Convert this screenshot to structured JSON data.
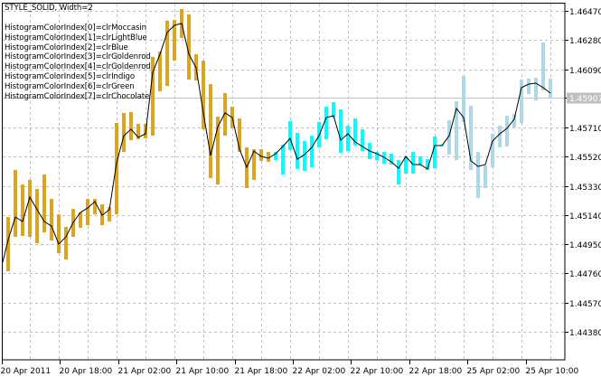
{
  "legend": {
    "title": "STYLE_SOLID,  Width=2",
    "lines": [
      "HistogramColorIndex[0]=clrMoccasin",
      "HistogramColorIndex[1]=clrLightBlue",
      "HistogramColorIndex[2]=clrBlue",
      "HistogramColorIndex[3]=clrGoldenrod",
      "HistogramColorIndex[4]=clrGoldenrod",
      "HistogramColorIndex[5]=clrIndigo",
      "HistogramColorIndex[6]=clrGreen",
      "HistogramColorIndex[7]=clrChocolate"
    ]
  },
  "chart_data": {
    "type": "bar",
    "subtype": "color-histogram2 with close line",
    "ylim": [
      1.4428,
      1.4654
    ],
    "y_ticks": [
      "1.46470",
      "1.46280",
      "1.46090",
      "1.45907",
      "1.45710",
      "1.45520",
      "1.45330",
      "1.45140",
      "1.44950",
      "1.44760",
      "1.44570",
      "1.44380"
    ],
    "current_price": "1.45907",
    "x_tick_labels": [
      "20 Apr 2011",
      "20 Apr 18:00",
      "21 Apr 02:00",
      "21 Apr 10:00",
      "21 Apr 18:00",
      "22 Apr 02:00",
      "22 Apr 10:00",
      "22 Apr 18:00",
      "25 Apr 02:00",
      "25 Apr 10:00"
    ],
    "grid": true,
    "colors": {
      "goldenrod": "#daa520",
      "cyan": "#00ffff",
      "lightblue": "#add8e6",
      "line": "#000000",
      "grid": "#c0c0c0",
      "price_line": "#c0c0c0"
    },
    "color_segments": [
      {
        "from": 0,
        "to": 37,
        "color": "goldenrod"
      },
      {
        "from": 38,
        "to": 61,
        "color": "cyan"
      },
      {
        "from": 62,
        "to": 76,
        "color": "lightblue"
      }
    ],
    "high": [
      1.44803,
      1.45127,
      1.45434,
      1.45339,
      1.45369,
      1.4531,
      1.45404,
      1.45245,
      1.45145,
      1.45063,
      1.4518,
      1.45157,
      1.45245,
      1.45245,
      1.4521,
      1.45192,
      1.4574,
      1.45805,
      1.45811,
      1.45734,
      1.45734,
      1.4617,
      1.46205,
      1.46406,
      1.46411,
      1.46482,
      1.46447,
      1.46188,
      1.46146,
      1.45993,
      1.45781,
      1.45934,
      1.45846,
      1.45769,
      1.45581,
      1.45569,
      1.45569,
      1.45551,
      1.45551,
      1.45599,
      1.45752,
      1.45675,
      1.45622,
      1.45657,
      1.45746,
      1.45846,
      1.45875,
      1.45828,
      1.45722,
      1.45769,
      1.45699,
      1.4561,
      1.45551,
      1.45551,
      1.4554,
      1.45498,
      1.45522,
      1.45551,
      1.45522,
      1.45504,
      1.45652,
      1.45599,
      1.45758,
      1.45881,
      1.46046,
      1.45852,
      1.45551,
      1.45463,
      1.45669,
      1.45722,
      1.45787,
      1.45799,
      1.46023,
      1.46029,
      1.46034,
      1.46264,
      1.46029
    ],
    "low": [
      1.44774,
      1.44774,
      1.44998,
      1.45004,
      1.44998,
      1.44957,
      1.45027,
      1.44974,
      1.44892,
      1.44851,
      1.44998,
      1.45057,
      1.45074,
      1.45145,
      1.45074,
      1.45098,
      1.45145,
      1.45551,
      1.45628,
      1.45634,
      1.4564,
      1.45657,
      1.45946,
      1.45981,
      1.46146,
      1.46294,
      1.46023,
      1.46017,
      1.45699,
      1.45381,
      1.45339,
      1.45657,
      1.45705,
      1.45551,
      1.45316,
      1.45369,
      1.45493,
      1.45487,
      1.45498,
      1.45404,
      1.45563,
      1.4544,
      1.45428,
      1.45451,
      1.45581,
      1.45634,
      1.45775,
      1.45546,
      1.45557,
      1.45593,
      1.45557,
      1.45504,
      1.45498,
      1.45475,
      1.45469,
      1.45339,
      1.4541,
      1.4541,
      1.45463,
      1.45434,
      1.45445,
      1.45593,
      1.45534,
      1.45498,
      1.45746,
      1.45434,
      1.45251,
      1.45316,
      1.45451,
      1.45581,
      1.45587,
      1.45711,
      1.4574,
      1.45928,
      1.45887,
      1.45952,
      1.45899
    ],
    "close": [
      1.44833,
      1.4498,
      1.45127,
      1.45098,
      1.45257,
      1.45175,
      1.45098,
      1.45068,
      1.44951,
      1.44998,
      1.45092,
      1.45157,
      1.45186,
      1.45228,
      1.45139,
      1.45175,
      1.45481,
      1.45657,
      1.45699,
      1.45646,
      1.45669,
      1.4607,
      1.46188,
      1.46329,
      1.46376,
      1.46388,
      1.46188,
      1.46099,
      1.45805,
      1.45528,
      1.45716,
      1.45805,
      1.45775,
      1.45569,
      1.45451,
      1.45557,
      1.45522,
      1.4551,
      1.4554,
      1.45587,
      1.4564,
      1.45504,
      1.45534,
      1.45581,
      1.45657,
      1.45775,
      1.45787,
      1.45628,
      1.45669,
      1.45616,
      1.45587,
      1.45557,
      1.4554,
      1.45516,
      1.45487,
      1.45445,
      1.45522,
      1.45469,
      1.45469,
      1.4544,
      1.45593,
      1.45593,
      1.45657,
      1.45834,
      1.45775,
      1.45493,
      1.45457,
      1.45469,
      1.45622,
      1.45669,
      1.45705,
      1.45764,
      1.4597,
      1.45993,
      1.45999,
      1.4597,
      1.45934
    ]
  }
}
